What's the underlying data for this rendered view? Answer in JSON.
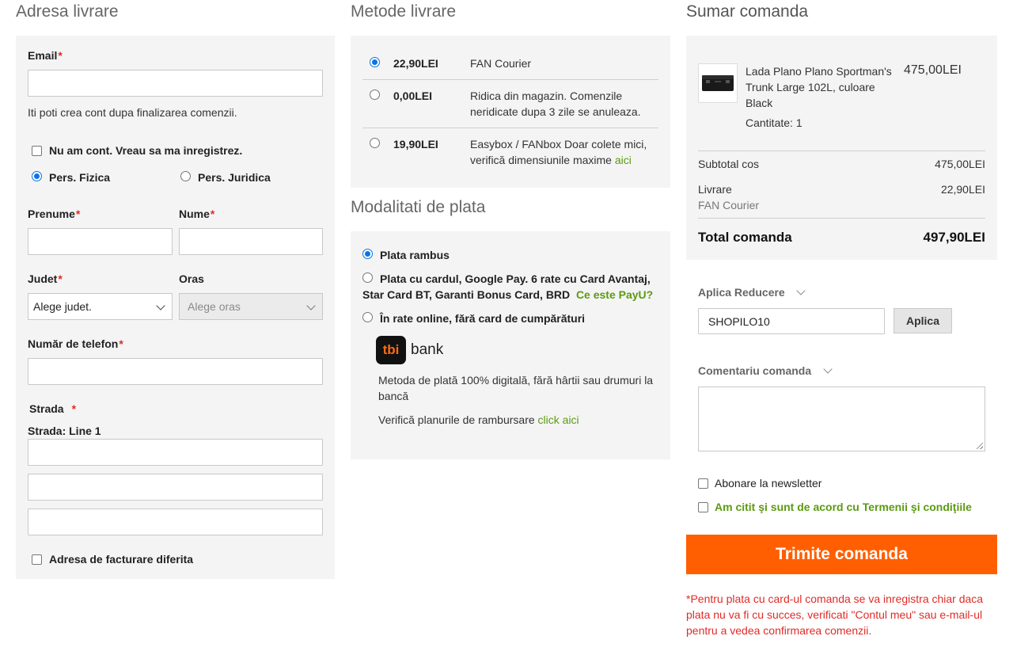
{
  "shipping_address": {
    "title": "Adresa livrare",
    "email_label": "Email",
    "email_value": "",
    "account_note": "Iti poti crea cont dupa finalizarea comenzii.",
    "register_label": "Nu am cont. Vreau sa ma inregistrez.",
    "person_type": {
      "fizica": "Pers. Fizica",
      "juridica": "Pers. Juridica",
      "selected": "fizica"
    },
    "firstname_label": "Prenume",
    "lastname_label": "Nume",
    "county_label": "Judet",
    "county_value": "Alege judet.",
    "city_label": "Oras",
    "city_value": "Alege oras",
    "phone_label": "Număr de telefon",
    "street_label": "Strada",
    "street_line1_label": "Strada: Line 1",
    "billing_diff_label": "Adresa de facturare diferita",
    "required_mark": "*"
  },
  "shipping_methods": {
    "title": "Metode livrare",
    "options": [
      {
        "price": "22,90LEI",
        "name": "FAN Courier",
        "selected": true
      },
      {
        "price": "0,00LEI",
        "name": "Ridica din magazin. Comenzile neridicate dupa 3 zile se anuleaza.",
        "selected": false
      },
      {
        "price": "19,90LEI",
        "name": "Easybox / FANbox Doar colete mici, verifică dimensiunile maxime",
        "link": "aici",
        "selected": false
      }
    ]
  },
  "payment_methods": {
    "title": "Modalitati de plata",
    "options": [
      {
        "label": "Plata rambus",
        "selected": true
      },
      {
        "label": "Plata cu cardul, Google Pay. 6 rate cu Card Avantaj, Star Card BT, Garanti Bonus Card, BRD",
        "link": "Ce este PayU?",
        "selected": false
      },
      {
        "label": "În rate online, fără card de cumpărături",
        "selected": false
      }
    ],
    "tbi": {
      "logo_text": "tbi",
      "brand": "bank",
      "description": "Metoda de plată 100% digitală, fără hârtii sau drumuri la bancă",
      "plans_text": "Verifică planurile de rambursare",
      "plans_link": "click aici"
    }
  },
  "order_summary": {
    "title": "Sumar comanda",
    "product": {
      "name": "Lada Plano Plano Sportman's Trunk Large 102L, culoare Black",
      "price": "475,00LEI",
      "qty_label": "Cantitate: 1"
    },
    "subtotal_label": "Subtotal cos",
    "subtotal_value": "475,00LEI",
    "shipping_label": "Livrare",
    "shipping_value": "22,90LEI",
    "shipping_method": "FAN Courier",
    "total_label": "Total comanda",
    "total_value": "497,90LEI",
    "discount_label": "Aplica Reducere",
    "discount_code": "SHOPILO10",
    "apply_label": "Aplica",
    "comment_label": "Comentariu comanda",
    "newsletter_label": "Abonare la newsletter",
    "terms_label": "Am citit şi sunt de acord cu Termenii şi condiţiile",
    "submit_label": "Trimite comanda",
    "card_note": "*Pentru plata cu card-ul comanda se va inregistra chiar daca plata nu va fi cu succes, verificati \"Contul meu\" sau e-mail-ul pentru a vedea confirmarea comenzii."
  },
  "colors": {
    "accent_orange": "#ff5f00",
    "link_green": "#5c9a12",
    "required_red": "#e02b27",
    "panel_bg": "#f4f4f4"
  }
}
